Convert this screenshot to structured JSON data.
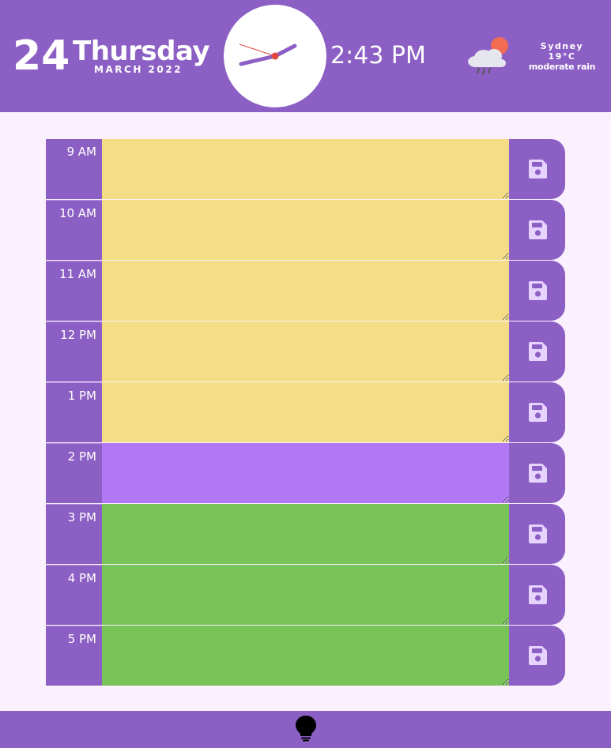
{
  "header": {
    "day_number": "24",
    "day_name": "Thursday",
    "month_year": "MARCH 2022",
    "time": "2:43 PM",
    "weather": {
      "city": "Sydney",
      "temperature": "19°C",
      "condition": "moderate rain",
      "icon": "cloud-rain-sun-icon"
    }
  },
  "schedule": {
    "hours": [
      {
        "label": "9 AM",
        "status": "past"
      },
      {
        "label": "10 AM",
        "status": "past"
      },
      {
        "label": "11 AM",
        "status": "past"
      },
      {
        "label": "12 PM",
        "status": "past"
      },
      {
        "label": "1 PM",
        "status": "past"
      },
      {
        "label": "2 PM",
        "status": "present"
      },
      {
        "label": "3 PM",
        "status": "future"
      },
      {
        "label": "4 PM",
        "status": "future"
      },
      {
        "label": "5 PM",
        "status": "future"
      }
    ],
    "save_icon": "floppy-disk-icon"
  },
  "footer": {
    "icon": "lightbulb-icon"
  },
  "colors": {
    "brand": "#8c5fc4",
    "past": "#f4dd86",
    "present": "#b177f4",
    "future": "#79c458"
  }
}
